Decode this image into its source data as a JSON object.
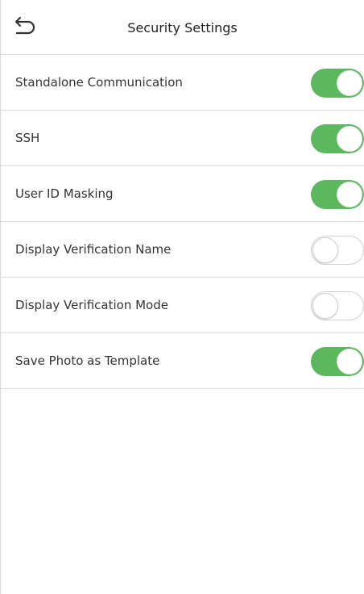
{
  "header": {
    "title": "Security Settings",
    "back_icon": "back-arrow-icon"
  },
  "colors": {
    "toggle_on": "#5cb85f",
    "toggle_off_border": "#cfcfcf",
    "divider": "#dcdcdc"
  },
  "settings": [
    {
      "label": "Standalone Communication",
      "enabled": true
    },
    {
      "label": "SSH",
      "enabled": true
    },
    {
      "label": "User ID Masking",
      "enabled": true
    },
    {
      "label": "Display Verification Name",
      "enabled": false
    },
    {
      "label": "Display Verification Mode",
      "enabled": false
    },
    {
      "label": "Save Photo as Template",
      "enabled": true
    }
  ]
}
